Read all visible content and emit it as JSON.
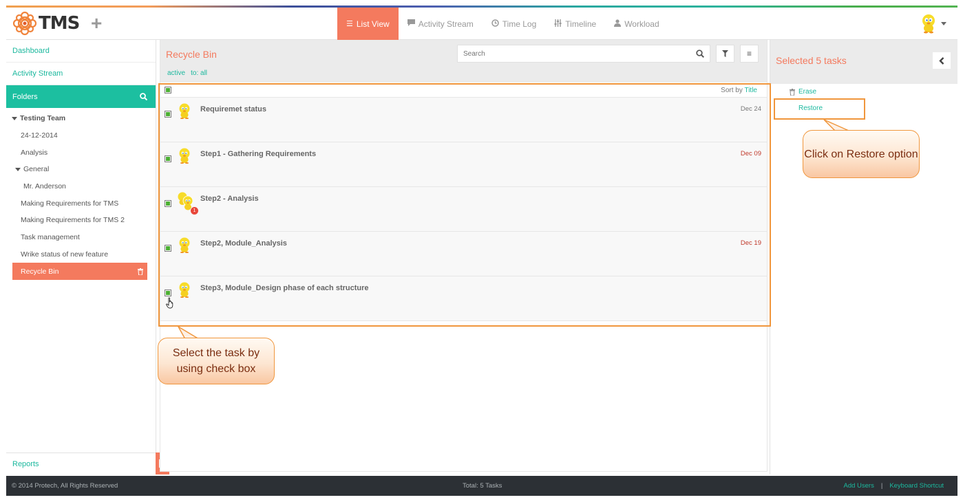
{
  "app": {
    "name": "TMS"
  },
  "header": {
    "nav": [
      {
        "label": "List View",
        "icon": "list-icon",
        "active": true
      },
      {
        "label": "Activity Stream",
        "icon": "comment-icon",
        "active": false
      },
      {
        "label": "Time Log",
        "icon": "clock-icon",
        "active": false
      },
      {
        "label": "Timeline",
        "icon": "sliders-icon",
        "active": false
      },
      {
        "label": "Workload",
        "icon": "user-icon",
        "active": false
      }
    ]
  },
  "sidebar": {
    "dashboard": "Dashboard",
    "activity_stream": "Activity Stream",
    "folders": "Folders",
    "tree": [
      {
        "label": "Testing Team"
      },
      {
        "label": "24-12-2014"
      },
      {
        "label": "Analysis"
      },
      {
        "label": "General"
      },
      {
        "label": "Mr. Anderson"
      },
      {
        "label": "Making Requirements for TMS"
      },
      {
        "label": "Making Requirements for TMS 2"
      },
      {
        "label": "Task management"
      },
      {
        "label": "Wrike status of new feature"
      },
      {
        "label": "Recycle Bin"
      }
    ],
    "reports": "Reports"
  },
  "main": {
    "title": "Recycle Bin",
    "filters": [
      "active",
      "to: all"
    ],
    "search_placeholder": "Search",
    "sort_label": "Sort by",
    "sort_value": "Title",
    "tasks": [
      {
        "title": "Requiremet status",
        "date": "Dec 24",
        "overdue": false
      },
      {
        "title": "Step1 - Gathering Requirements",
        "date": "Dec 09",
        "overdue": true
      },
      {
        "title": "Step2 - Analysis",
        "date": "",
        "badge": "1"
      },
      {
        "title": "Step2, Module_Analysis",
        "date": "Dec 19",
        "overdue": true
      },
      {
        "title": "Step3, Module_Design phase of each structure",
        "date": ""
      }
    ]
  },
  "right_panel": {
    "title": "Selected 5 tasks",
    "erase": "Erase",
    "restore": "Restore"
  },
  "callouts": {
    "restore": "Click on Restore option",
    "select": "Select the task by using check box"
  },
  "footer": {
    "copyright": "© 2014 Protech, All Rights Reserved",
    "total": "Total: 5 Tasks",
    "add_users": "Add Users",
    "sep": "|",
    "keyboard": "Keyboard Shortcut"
  },
  "colors": {
    "accent": "#f47a5e",
    "teal": "#1cbfa0",
    "callout_border": "#f0963c"
  }
}
